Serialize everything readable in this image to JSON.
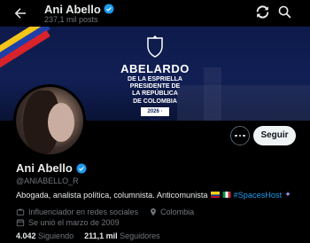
{
  "header": {
    "name": "Ani Abello",
    "posts": "237,1 mil posts"
  },
  "banner": {
    "name": "ABELARDO",
    "line1": "DE LA ESPRIELLA",
    "line2": "PRESIDENTE DE",
    "line3": "LA REPÚBLICA",
    "line4": "DE COLOMBIA",
    "years": "2026 · 2030"
  },
  "actions": {
    "follow_label": "Seguir"
  },
  "profile": {
    "name": "Ani Abello",
    "handle": "@ANIABELLO_R",
    "bio": "Abogada, analista política, columnista. Anticomunista",
    "hashtag": "#SpacesHost",
    "category": "Influenciador en redes sociales",
    "location": "Colombia",
    "joined": "Se unió el marzo de 2009"
  },
  "stats": {
    "following_count": "4.042",
    "following_label": "Siguiendo",
    "followers_count": "211,1 mil",
    "followers_label": "Seguidores"
  },
  "colors": {
    "accent": "#1d9bf0",
    "background": "#000000",
    "secondary_text": "#71767b"
  },
  "icons": [
    "back-arrow-icon",
    "verified-badge-icon",
    "refresh-icon",
    "search-icon",
    "more-icon",
    "briefcase-icon",
    "location-pin-icon",
    "calendar-icon"
  ]
}
